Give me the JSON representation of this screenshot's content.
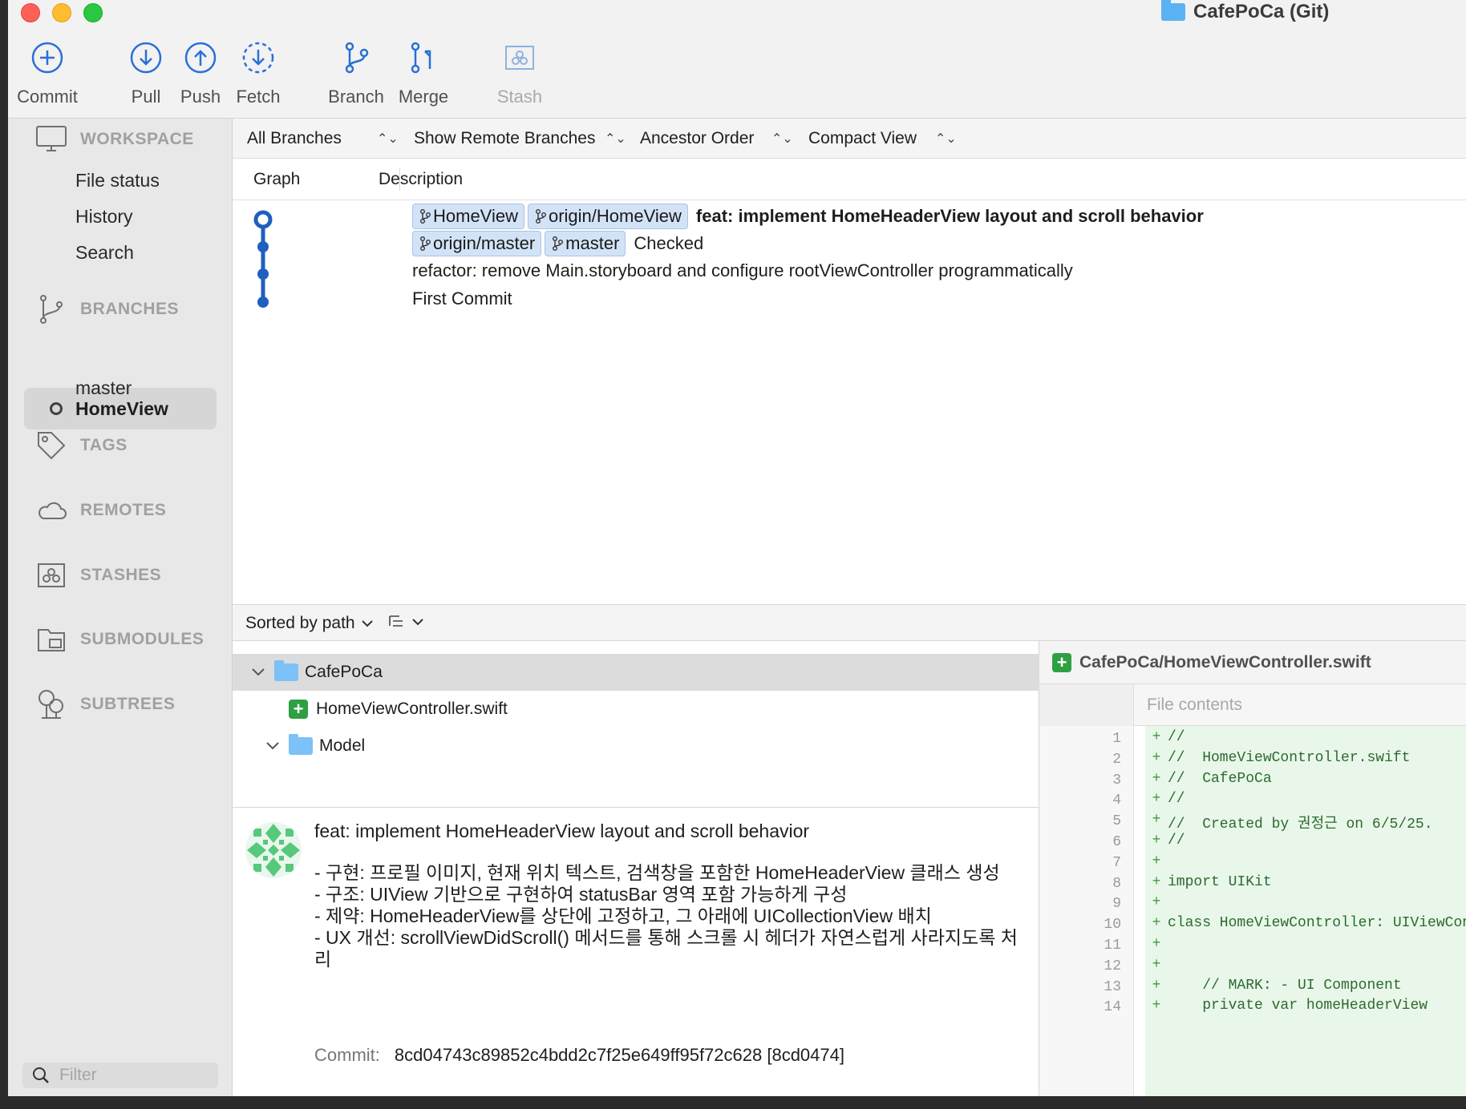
{
  "window": {
    "title": "CafePoCa (Git)"
  },
  "toolbar": {
    "commit": "Commit",
    "pull": "Pull",
    "push": "Push",
    "fetch": "Fetch",
    "branch": "Branch",
    "merge": "Merge",
    "stash": "Stash"
  },
  "sidebar": {
    "workspace": "WORKSPACE",
    "file_status": "File status",
    "history": "History",
    "search": "Search",
    "branches": "BRANCHES",
    "branch_current": "HomeView",
    "branch_master": "master",
    "tags": "TAGS",
    "remotes": "REMOTES",
    "stashes": "STASHES",
    "submodules": "SUBMODULES",
    "subtrees": "SUBTREES",
    "filter_placeholder": "Filter"
  },
  "filterbar": {
    "branches": "All Branches",
    "remote": "Show Remote Branches",
    "order": "Ancestor Order",
    "view": "Compact View"
  },
  "columns": {
    "graph": "Graph",
    "description": "Description"
  },
  "commits": [
    {
      "refs": [
        "HomeView",
        "origin/HomeView"
      ],
      "message": "feat: implement HomeHeaderView layout and scroll behavior",
      "bold": true
    },
    {
      "refs": [
        "origin/master",
        "master"
      ],
      "message": "Checked",
      "bold": false
    },
    {
      "refs": [],
      "message": "refactor: remove Main.storyboard and configure rootViewController programmatically",
      "bold": false
    },
    {
      "refs": [],
      "message": "First Commit",
      "bold": false
    }
  ],
  "sortbar": {
    "label": "Sorted by path"
  },
  "filetree": {
    "folder_root": "CafePoCa",
    "file": "HomeViewController.swift",
    "folder_model": "Model"
  },
  "details": {
    "title": "feat: implement HomeHeaderView layout and scroll behavior",
    "body": "- 구현: 프로필 이미지, 현재 위치 텍스트, 검색창을 포함한 HomeHeaderView 클래스 생성\n- 구조: UIView 기반으로 구현하여 statusBar 영역 포함 가능하게 구성\n- 제약: HomeHeaderView를 상단에 고정하고, 그 아래에 UICollectionView 배치\n- UX 개선: scrollViewDidScroll() 메서드를 통해 스크롤 시 헤더가 자연스럽게 사라지도록 처리",
    "commit_label": "Commit:",
    "commit_hash": "8cd04743c89852c4bdd2c7f25e649ff95f72c628 [8cd0474]"
  },
  "diff": {
    "file_path": "CafePoCa/HomeViewController.swift",
    "contents_label": "File contents",
    "lines": [
      {
        "n": "1",
        "code": "//"
      },
      {
        "n": "2",
        "code": "//  HomeViewController.swift"
      },
      {
        "n": "3",
        "code": "//  CafePoCa"
      },
      {
        "n": "4",
        "code": "//"
      },
      {
        "n": "5",
        "code": "//  Created by 권정근 on 6/5/25."
      },
      {
        "n": "6",
        "code": "//"
      },
      {
        "n": "7",
        "code": ""
      },
      {
        "n": "8",
        "code": "import UIKit"
      },
      {
        "n": "9",
        "code": ""
      },
      {
        "n": "10",
        "code": "class HomeViewController: UIViewController {"
      },
      {
        "n": "11",
        "code": ""
      },
      {
        "n": "12",
        "code": ""
      },
      {
        "n": "13",
        "code": "    // MARK: - UI Component"
      },
      {
        "n": "14",
        "code": "    private var homeHeaderView"
      }
    ]
  },
  "colors": {
    "accent": "#1f5fbf",
    "ref_bg": "#d3e3f7",
    "added": "#2ea043"
  }
}
